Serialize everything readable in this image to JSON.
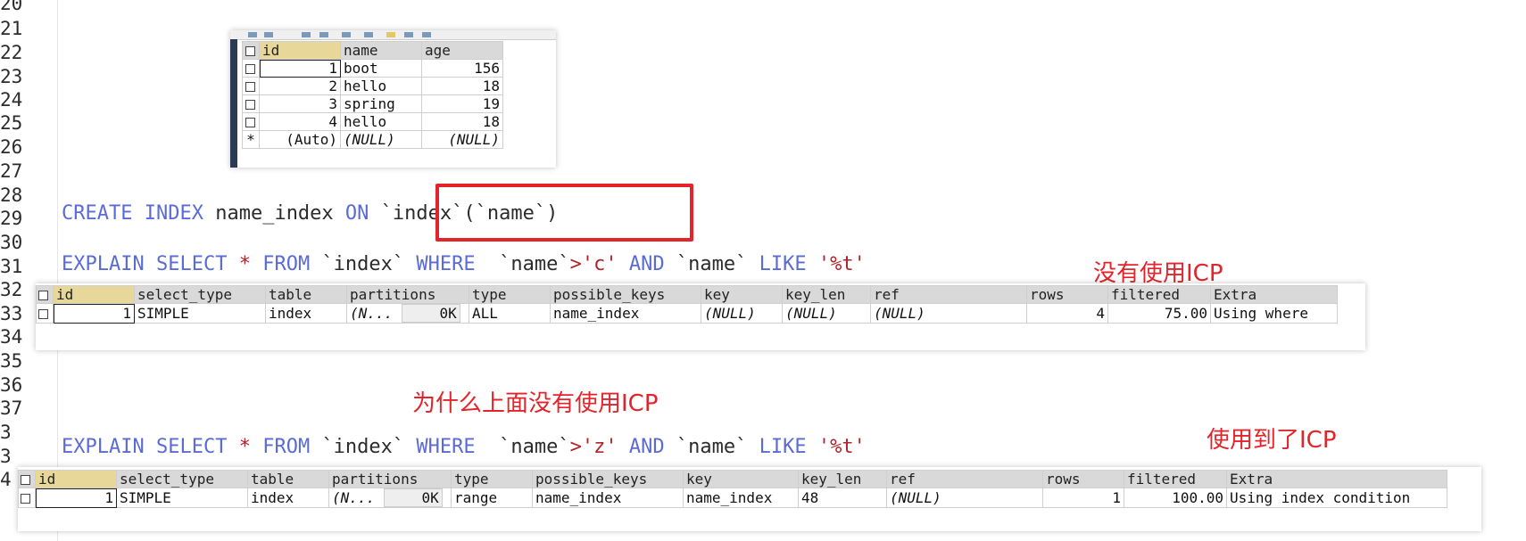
{
  "line_numbers": [
    "20",
    "21",
    "22",
    "23",
    "24",
    "25",
    "26",
    "27",
    "28",
    "29",
    "30",
    "31",
    "32",
    "33",
    "34",
    "35",
    "36",
    "37",
    "3",
    "3",
    "4"
  ],
  "code_lines": {
    "create_index": {
      "kw1": "CREATE",
      "kw2": "INDEX",
      "name": "name_index",
      "kw3": "ON",
      "target": "`index`(`name`)"
    },
    "explain_1": {
      "kw1": "EXPLAIN",
      "kw2": "SELECT",
      "star": "*",
      "kw3": "FROM",
      "table": "`index`",
      "kw4": "WHERE",
      "col1": "`name`",
      "op": ">",
      "val1": "'c'",
      "kw5": "AND",
      "col2": "`name`",
      "kw6": "LIKE",
      "val2": "'%t'"
    },
    "explain_2": {
      "kw1": "EXPLAIN",
      "kw2": "SELECT",
      "star": "*",
      "kw3": "FROM",
      "table": "`index`",
      "kw4": "WHERE",
      "col1": "`name`",
      "op": ">",
      "val1": "'z'",
      "kw5": "AND",
      "col2": "`name`",
      "kw6": "LIKE",
      "val2": "'%t'"
    }
  },
  "annotations": {
    "no_icp": "没有使用ICP",
    "why_no_icp": "为什么上面没有使用ICP",
    "used_icp": "使用到了ICP"
  },
  "table_grid": {
    "headers": [
      "id",
      "name",
      "age"
    ],
    "rows": [
      [
        "1",
        "boot",
        "156"
      ],
      [
        "2",
        "hello",
        "18"
      ],
      [
        "3",
        "spring",
        "19"
      ],
      [
        "4",
        "hello",
        "18"
      ]
    ],
    "new_row": [
      "(Auto)",
      "(NULL)",
      "(NULL)"
    ],
    "new_row_marker": "*"
  },
  "explain_grid_1": {
    "headers": [
      "id",
      "select_type",
      "table",
      "partitions",
      "type",
      "possible_keys",
      "key",
      "key_len",
      "ref",
      "rows",
      "filtered",
      "Extra"
    ],
    "row": {
      "id": "1",
      "select_type": "SIMPLE",
      "table": "index",
      "partitions": "(N...",
      "partitions_size": "0K",
      "type": "ALL",
      "possible_keys": "name_index",
      "key": "(NULL)",
      "key_len": "(NULL)",
      "ref": "(NULL)",
      "rows": "4",
      "filtered": "75.00",
      "extra": "Using where"
    }
  },
  "explain_grid_2": {
    "headers": [
      "id",
      "select_type",
      "table",
      "partitions",
      "type",
      "possible_keys",
      "key",
      "key_len",
      "ref",
      "rows",
      "filtered",
      "Extra"
    ],
    "row": {
      "id": "1",
      "select_type": "SIMPLE",
      "table": "index",
      "partitions": "(N...",
      "partitions_size": "0K",
      "type": "range",
      "possible_keys": "name_index",
      "key": "name_index",
      "key_len": "48",
      "ref": "(NULL)",
      "rows": "1",
      "filtered": "100.00",
      "extra": "Using index condition"
    }
  },
  "colors": {
    "keyword": "#5b6bd6",
    "string": "#b4222a",
    "annotation": "#e3242b",
    "header_bg": "#d9d9d9"
  }
}
